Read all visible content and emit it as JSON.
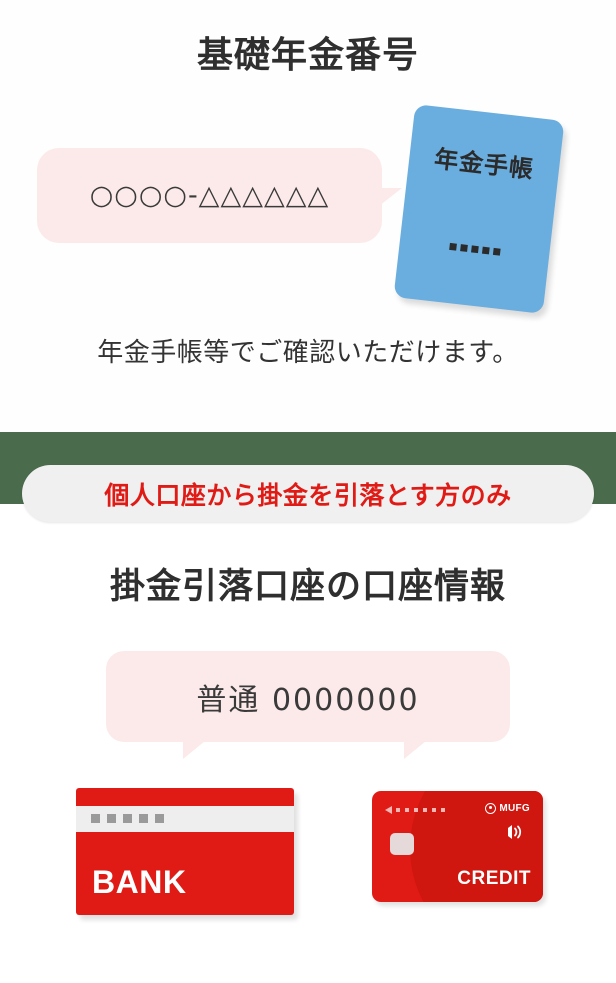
{
  "section_one": {
    "title": "基礎年金番号",
    "bubble_value": "○○○○-△△△△△△",
    "booklet_label": "年金手帳",
    "booklet_marks_count": 5,
    "caption": "年金手帳等でご確認いただけます。"
  },
  "divider": {
    "color": "#4a6b4c"
  },
  "section_two": {
    "notice_pill": "個人口座から掛金を引落とす方のみ",
    "notice_pill_color": "#e01b16",
    "title": "掛金引落口座の口座情報",
    "bubble_value": "普通 0000000",
    "bank_card": {
      "label": "BANK",
      "color": "#e01b16",
      "stripe_dots_count": 5
    },
    "credit_card": {
      "brand": "MUFG",
      "label": "CREDIT",
      "color": "#e01b16",
      "top_dots_count": 6
    }
  },
  "colors": {
    "bubble_pink": "#fceaea",
    "booklet_blue": "#6aaddf",
    "pill_gray": "#f0f0f0",
    "text_dark": "#2f2f2f"
  }
}
